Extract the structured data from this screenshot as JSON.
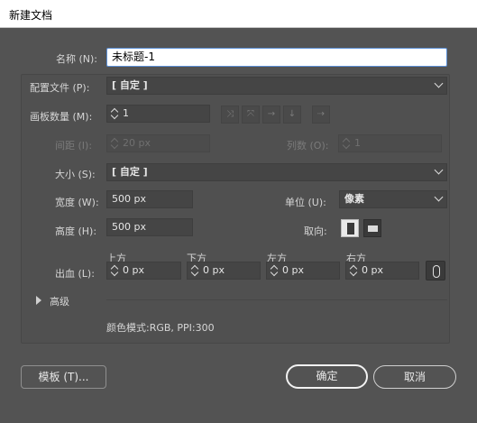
{
  "window": {
    "title": "新建文档"
  },
  "name": {
    "label": "名称 (N):",
    "value": "未标题-1"
  },
  "profile": {
    "label": "配置文件 (P):",
    "value": "[ 自定 ]"
  },
  "artboards": {
    "count_label": "画板数量 (M):",
    "count_value": "1",
    "spacing_label": "间距 (I):",
    "spacing_value": "20 px",
    "columns_label": "列数 (O):",
    "columns_value": "1",
    "arrange_icons": [
      "grid-by-row-icon",
      "grid-by-column-icon",
      "arrange-by-row-icon",
      "arrange-by-column-icon",
      "right-to-left-icon"
    ]
  },
  "size": {
    "label": "大小 (S):",
    "value": "[ 自定 ]"
  },
  "width": {
    "label": "宽度 (W):",
    "value": "500 px"
  },
  "height": {
    "label": "高度 (H):",
    "value": "500 px"
  },
  "units": {
    "label": "单位 (U):",
    "value": "像素"
  },
  "orientation": {
    "label": "取向:"
  },
  "bleed": {
    "label": "出血 (L):",
    "top_label": "上方",
    "top_value": "0 px",
    "bottom_label": "下方",
    "bottom_value": "0 px",
    "left_label": "左方",
    "left_value": "0 px",
    "right_label": "右方",
    "right_value": "0 px"
  },
  "advanced": {
    "label": "高级",
    "info": "颜色模式:RGB, PPI:300"
  },
  "buttons": {
    "templates": "模板 (T)...",
    "ok": "确定",
    "cancel": "取消"
  },
  "colors": {
    "dialog_bg": "#535353",
    "field_bg": "#454545",
    "title_bg": "#ffffff"
  }
}
